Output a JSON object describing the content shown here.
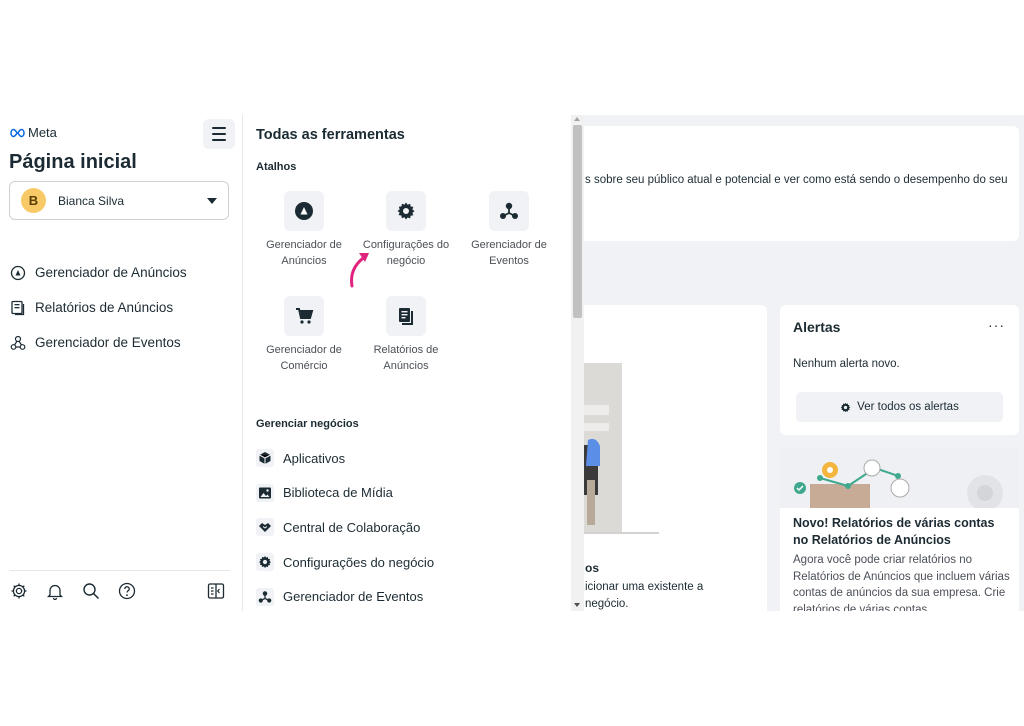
{
  "sidebar": {
    "logo_text": "Meta",
    "page_title": "Página inicial",
    "account": {
      "initial": "B",
      "name": "Bianca Silva"
    },
    "nav": [
      {
        "label": "Gerenciador de Anúncios",
        "icon": "ads-manager-icon"
      },
      {
        "label": "Relatórios de Anúncios",
        "icon": "ads-reporting-icon"
      },
      {
        "label": "Gerenciador de Eventos",
        "icon": "events-manager-icon"
      }
    ],
    "footer_icons": [
      "settings-icon",
      "notifications-icon",
      "search-icon",
      "help-icon",
      "panel-toggle-icon"
    ]
  },
  "tools": {
    "title": "Todas as ferramentas",
    "shortcuts_label": "Atalhos",
    "shortcuts": [
      {
        "label": "Gerenciador de Anúncios",
        "icon": "ads-manager-icon"
      },
      {
        "label": "Configurações do negócio",
        "icon": "gear-icon"
      },
      {
        "label": "Gerenciador de Eventos",
        "icon": "events-manager-icon"
      },
      {
        "label": "Gerenciador de Comércio",
        "icon": "cart-icon"
      },
      {
        "label": "Relatórios de Anúncios",
        "icon": "ads-reporting-icon"
      }
    ],
    "manage_label": "Gerenciar negócios",
    "manage_items": [
      {
        "label": "Aplicativos",
        "icon": "cube-icon"
      },
      {
        "label": "Biblioteca de Mídia",
        "icon": "image-icon"
      },
      {
        "label": "Central de Colaboração",
        "icon": "handshake-icon"
      },
      {
        "label": "Configurações do negócio",
        "icon": "gear-icon"
      },
      {
        "label": "Gerenciador de Eventos",
        "icon": "events-manager-icon"
      }
    ]
  },
  "dashboard": {
    "top_card_text": "s sobre seu público atual e potencial e ver como está sendo o desempenho do seu",
    "left_card": {
      "title_fragment": "os",
      "line1": "icionar uma existente a",
      "line2": "negócio."
    },
    "alerts": {
      "title": "Alertas",
      "more": "···",
      "empty": "Nenhum alerta novo.",
      "button": "Ver todos os alertas"
    },
    "news": {
      "title": "Novo! Relatórios de várias contas no Relatórios de Anúncios",
      "body": "Agora você pode criar relatórios no Relatórios de Anúncios que incluem várias contas de anúncios da sua empresa. Crie relatórios de várias contas"
    }
  },
  "colors": {
    "accent_pink": "#e0237e",
    "avatar_yellow": "#f7c967",
    "panel_gray": "#f0f2f5"
  }
}
